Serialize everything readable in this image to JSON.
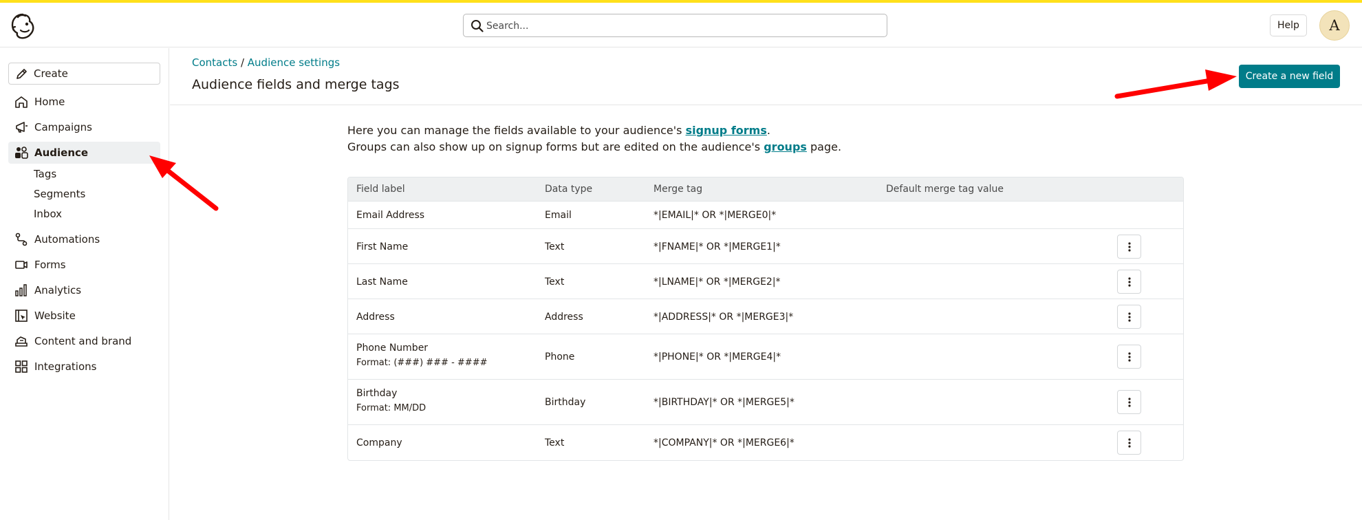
{
  "header": {
    "search_placeholder": "Search...",
    "help_label": "Help",
    "avatar_initial": "A"
  },
  "sidebar": {
    "create_label": "Create",
    "items": [
      {
        "label": "Home",
        "icon": "home-icon"
      },
      {
        "label": "Campaigns",
        "icon": "megaphone-icon"
      },
      {
        "label": "Audience",
        "icon": "audience-icon",
        "active": true
      },
      {
        "label": "Automations",
        "icon": "automations-icon"
      },
      {
        "label": "Forms",
        "icon": "forms-icon"
      },
      {
        "label": "Analytics",
        "icon": "analytics-icon"
      },
      {
        "label": "Website",
        "icon": "website-icon"
      },
      {
        "label": "Content and brand",
        "icon": "content-brand-icon"
      },
      {
        "label": "Integrations",
        "icon": "integrations-icon"
      }
    ],
    "audience_sub": [
      "Tags",
      "Segments",
      "Inbox"
    ]
  },
  "breadcrumb": {
    "contacts": "Contacts",
    "separator": " / ",
    "audience_settings": "Audience settings"
  },
  "page": {
    "title": "Audience fields and merge tags",
    "create_field_label": "Create a new field"
  },
  "intro": {
    "line1_pre": "Here you can manage the fields available to your audience's ",
    "line1_link": "signup forms",
    "line1_post": ".",
    "line2_pre": "Groups can also show up on signup forms but are edited on the audience's ",
    "line2_link": "groups",
    "line2_post": " page."
  },
  "table": {
    "headers": [
      "Field label",
      "Data type",
      "Merge tag",
      "Default merge tag value"
    ],
    "rows": [
      {
        "label": "Email Address",
        "format": "",
        "type": "Email",
        "tag": "*|EMAIL|* OR *|MERGE0|*",
        "default": "",
        "menu": false
      },
      {
        "label": "First Name",
        "format": "",
        "type": "Text",
        "tag": "*|FNAME|* OR *|MERGE1|*",
        "default": "",
        "menu": true
      },
      {
        "label": "Last Name",
        "format": "",
        "type": "Text",
        "tag": "*|LNAME|* OR *|MERGE2|*",
        "default": "",
        "menu": true
      },
      {
        "label": "Address",
        "format": "",
        "type": "Address",
        "tag": "*|ADDRESS|* OR *|MERGE3|*",
        "default": "",
        "menu": true
      },
      {
        "label": "Phone Number",
        "format": "Format: (###) ### - ####",
        "type": "Phone",
        "tag": "*|PHONE|* OR *|MERGE4|*",
        "default": "",
        "menu": true
      },
      {
        "label": "Birthday",
        "format": "Format: MM/DD",
        "type": "Birthday",
        "tag": "*|BIRTHDAY|* OR *|MERGE5|*",
        "default": "",
        "menu": true
      },
      {
        "label": "Company",
        "format": "",
        "type": "Text",
        "tag": "*|COMPANY|* OR *|MERGE6|*",
        "default": "",
        "menu": true
      }
    ]
  },
  "colors": {
    "accent": "#007c89",
    "top_stripe": "#ffe01b",
    "annotation_arrow": "#ff0000"
  }
}
